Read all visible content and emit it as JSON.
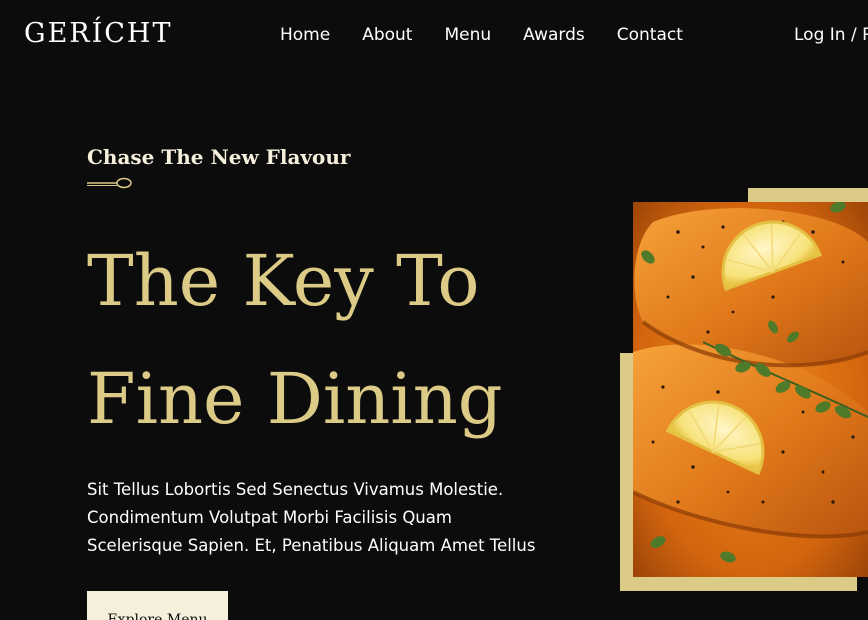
{
  "brand": {
    "logo": "GERÍCHT"
  },
  "nav": {
    "items": [
      "Home",
      "About",
      "Menu",
      "Awards",
      "Contact"
    ],
    "login": "Log In / R"
  },
  "hero": {
    "subtitle": "Chase The New Flavour",
    "headline_line1": "The Key To",
    "headline_line2": "Fine Dining",
    "description": "Sit Tellus Lobortis Sed Senectus Vivamus Molestie. Condimentum Volutpat Morbi Facilisis Quam Scelerisque Sapien. Et, Penatibus Aliquam Amet Tellus",
    "cta": "Explore Menu"
  },
  "colors": {
    "background": "#0C0C0C",
    "gold": "#DCCA87",
    "cream": "#F5EFDB",
    "white": "#FFFFFF"
  },
  "icons": {
    "spoon": "spoon-icon",
    "hero_image": "salmon-lemon-dish-image"
  }
}
